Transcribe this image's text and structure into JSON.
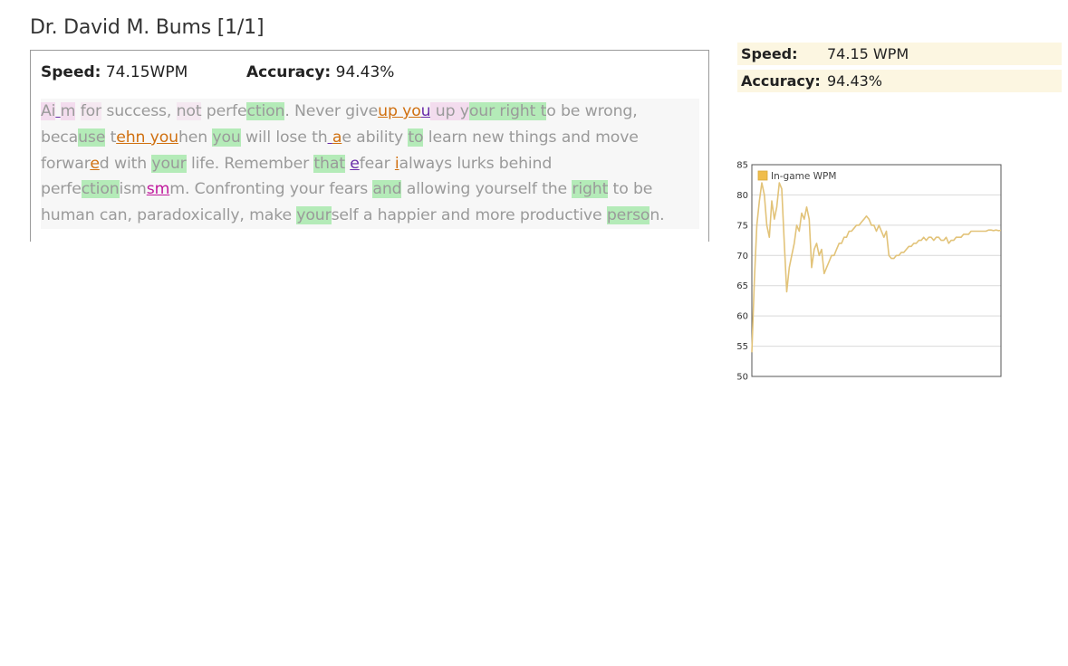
{
  "header": {
    "title": "Dr. David M. Bums [1/1]"
  },
  "replay": {
    "speed_label": "Speed:",
    "speed_value": "74.15WPM",
    "accuracy_label": "Accuracy:",
    "accuracy_value": "94.43%"
  },
  "passage_lines": [
    [
      {
        "t": "Ai",
        "c": "p"
      },
      {
        "t": " ",
        "c": "err-v"
      },
      {
        "t": "m",
        "c": "p"
      },
      {
        "t": " ",
        "c": ""
      },
      {
        "t": "for",
        "c": "pg"
      },
      {
        "t": " success, ",
        "c": ""
      },
      {
        "t": "not",
        "c": "pg"
      },
      {
        "t": " perfe",
        "c": ""
      },
      {
        "t": "ction",
        "c": "g"
      },
      {
        "t": ". Never give",
        "c": ""
      },
      {
        "t": "up yo",
        "c": "err-o"
      },
      {
        "t": "u",
        "c": "err-v"
      },
      {
        "t": " up y",
        "c": "p"
      },
      {
        "t": "our right t",
        "c": "g"
      },
      {
        "t": "o be wrong,",
        "c": ""
      }
    ],
    [
      {
        "t": "beca",
        "c": ""
      },
      {
        "t": "use",
        "c": "g"
      },
      {
        "t": " t",
        "c": ""
      },
      {
        "t": "ehn you",
        "c": "err-o"
      },
      {
        "t": "hen ",
        "c": ""
      },
      {
        "t": "you",
        "c": "g"
      },
      {
        "t": " will lose th",
        "c": ""
      },
      {
        "t": " ",
        "c": "err-v"
      },
      {
        "t": "a",
        "c": "err-o"
      },
      {
        "t": "e ability ",
        "c": ""
      },
      {
        "t": "to",
        "c": "g"
      },
      {
        "t": " learn new things and move",
        "c": ""
      }
    ],
    [
      {
        "t": "forwar",
        "c": ""
      },
      {
        "t": "e",
        "c": "err-o"
      },
      {
        "t": "d with ",
        "c": ""
      },
      {
        "t": "your",
        "c": "g"
      },
      {
        "t": " life. Remember ",
        "c": ""
      },
      {
        "t": "that",
        "c": "g"
      },
      {
        "t": " ",
        "c": ""
      },
      {
        "t": "e",
        "c": "err-v"
      },
      {
        "t": "fear ",
        "c": ""
      },
      {
        "t": "i",
        "c": "err-o"
      },
      {
        "t": "always lurks behind",
        "c": ""
      }
    ],
    [
      {
        "t": "perfe",
        "c": ""
      },
      {
        "t": "ction",
        "c": "g"
      },
      {
        "t": "ism",
        "c": ""
      },
      {
        "t": "sm",
        "c": "err-m"
      },
      {
        "t": "m. Confronting your fears ",
        "c": ""
      },
      {
        "t": "and",
        "c": "g"
      },
      {
        "t": " allowing yourself the ",
        "c": ""
      },
      {
        "t": "right",
        "c": "g"
      },
      {
        "t": " to be",
        "c": ""
      }
    ],
    [
      {
        "t": "human can, paradoxically, make ",
        "c": ""
      },
      {
        "t": "your",
        "c": "g"
      },
      {
        "t": "self a happier and more productive ",
        "c": ""
      },
      {
        "t": "perso",
        "c": "g"
      },
      {
        "t": "n.",
        "c": ""
      }
    ]
  ],
  "summary": {
    "speed_label": "Speed:",
    "speed_value": "74.15 WPM",
    "accuracy_label": "Accuracy:",
    "accuracy_value": "94.43%"
  },
  "colors": {
    "series": "#e2c379",
    "legend_swatch": "#f0bd4c",
    "grid": "#d9d9d9",
    "axis": "#555555"
  },
  "chart_data": {
    "type": "line",
    "title": "",
    "xlabel": "",
    "ylabel": "",
    "ylim": [
      50,
      85
    ],
    "yticks": [
      50,
      55,
      60,
      65,
      70,
      75,
      80,
      85
    ],
    "grid": true,
    "legend_position": "top-left",
    "series": [
      {
        "name": "In-game WPM",
        "x": [
          0,
          1,
          2,
          3,
          4,
          5,
          6,
          7,
          8,
          9,
          10,
          11,
          12,
          13,
          14,
          15,
          16,
          17,
          18,
          19,
          20,
          21,
          22,
          23,
          24,
          25,
          26,
          27,
          28,
          29,
          30,
          31,
          32,
          33,
          34,
          35,
          36,
          37,
          38,
          39,
          40,
          41,
          42,
          43,
          44,
          45,
          46,
          47,
          48,
          49,
          50,
          51,
          52,
          53,
          54,
          55,
          56,
          57,
          58,
          59,
          60,
          61,
          62,
          63,
          64,
          65,
          66,
          67,
          68,
          69,
          70,
          71,
          72,
          73,
          74,
          75,
          76,
          77,
          78,
          79,
          80,
          81,
          82,
          83,
          84,
          85,
          86,
          87,
          88,
          89,
          90,
          91,
          92,
          93,
          94,
          95,
          96,
          97,
          98,
          99,
          100
        ],
        "values": [
          54,
          66,
          75,
          79,
          82,
          80,
          75,
          73,
          79,
          76,
          78,
          82,
          81,
          72,
          64,
          68,
          70,
          72,
          75,
          74,
          77,
          76,
          78,
          76,
          68,
          71,
          72,
          70,
          71,
          67,
          68,
          69,
          70,
          70,
          71,
          72,
          72,
          73,
          73,
          74,
          74,
          74.5,
          75,
          75,
          75.5,
          76,
          76.5,
          76,
          75,
          75,
          74,
          75,
          74,
          73,
          74,
          70,
          69.5,
          69.5,
          70,
          70,
          70.5,
          70.5,
          71,
          71.5,
          71.5,
          72,
          72,
          72.5,
          72.5,
          73,
          72.5,
          73,
          73,
          72.5,
          73,
          73,
          72.5,
          72.5,
          73,
          72,
          72.5,
          72.5,
          73,
          73,
          73,
          73.5,
          73.5,
          73.5,
          74,
          74,
          74,
          74,
          74,
          74,
          74,
          74.2,
          74.2,
          74.1,
          74.2,
          74.1,
          74.15
        ]
      }
    ]
  }
}
